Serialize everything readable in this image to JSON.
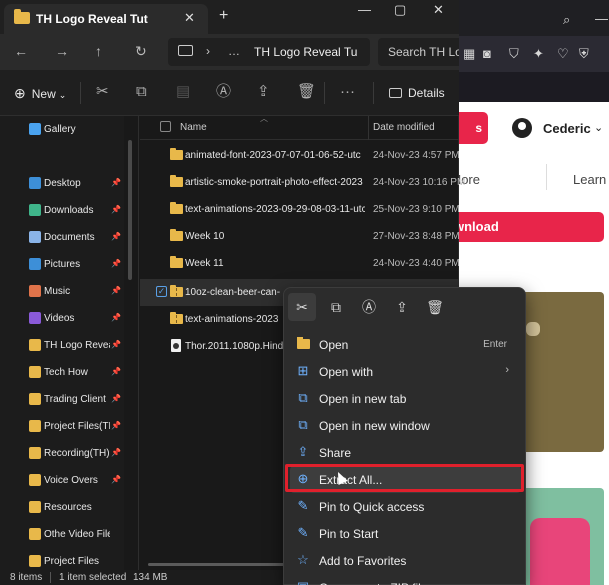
{
  "browser": {
    "user_name": "Cederic",
    "tab_more": "More",
    "tab_learn": "Learn",
    "download_label": "Download"
  },
  "explorer": {
    "tab_title": "TH Logo Reveal Tut",
    "close_tab": "✕",
    "new_tab": "+",
    "window_minimize": "—",
    "window_maximize": "▢",
    "window_close": "✕",
    "address_crumb": "TH Logo Reveal Tu",
    "search_placeholder": "Search TH Logo",
    "toolbar": {
      "new_label": "New",
      "details_label": "Details"
    },
    "sidebar": [
      {
        "label": "Gallery",
        "icon": "gallery-icon",
        "color": "#4aa3f0",
        "pinned": false
      },
      {
        "label": "Desktop",
        "icon": "desktop-icon",
        "color": "#3d8fd8",
        "pinned": true
      },
      {
        "label": "Downloads",
        "icon": "downloads-icon",
        "color": "#3fb58a",
        "pinned": true
      },
      {
        "label": "Documents",
        "icon": "documents-icon",
        "color": "#8ab4e8",
        "pinned": true
      },
      {
        "label": "Pictures",
        "icon": "pictures-icon",
        "color": "#3d8fd8",
        "pinned": true
      },
      {
        "label": "Music",
        "icon": "music-icon",
        "color": "#e0734a",
        "pinned": true
      },
      {
        "label": "Videos",
        "icon": "videos-icon",
        "color": "#8a5ad8",
        "pinned": true
      },
      {
        "label": "TH Logo Reveal",
        "icon": "folder-icon",
        "color": "#e8b84a",
        "pinned": true
      },
      {
        "label": "Tech How",
        "icon": "folder-icon",
        "color": "#e8b84a",
        "pinned": true
      },
      {
        "label": "Trading Client",
        "icon": "folder-icon",
        "color": "#e8b84a",
        "pinned": true
      },
      {
        "label": "Project Files(TH",
        "icon": "folder-icon",
        "color": "#e8b84a",
        "pinned": true
      },
      {
        "label": "Recording(TH)",
        "icon": "folder-icon",
        "color": "#e8b84a",
        "pinned": true
      },
      {
        "label": "Voice Overs",
        "icon": "folder-icon",
        "color": "#e8b84a",
        "pinned": true
      },
      {
        "label": "Resources",
        "icon": "folder-icon",
        "color": "#e8b84a",
        "pinned": false
      },
      {
        "label": "Othe Video Files",
        "icon": "folder-icon",
        "color": "#e8b84a",
        "pinned": false
      },
      {
        "label": "Project Files",
        "icon": "folder-icon",
        "color": "#e8b84a",
        "pinned": false
      }
    ],
    "columns": {
      "name": "Name",
      "date": "Date modified"
    },
    "files": [
      {
        "name": "animated-font-2023-07-07-01-06-52-utc",
        "date": "24-Nov-23 4:57 PM",
        "type": "folder"
      },
      {
        "name": "artistic-smoke-portrait-photo-effect-2023",
        "date": "24-Nov-23 10:16 PM",
        "type": "folder"
      },
      {
        "name": "text-animations-2023-09-29-08-03-11-utc",
        "date": "25-Nov-23 9:10 PM",
        "type": "folder"
      },
      {
        "name": "Week 10",
        "date": "27-Nov-23 8:48 PM",
        "type": "folder"
      },
      {
        "name": "Week 11",
        "date": "24-Nov-23 4:40 PM",
        "type": "folder"
      },
      {
        "name": "10oz-clean-beer-can-",
        "date": "",
        "type": "zip",
        "selected": true
      },
      {
        "name": "text-animations-2023",
        "date": "",
        "type": "zip"
      },
      {
        "name": "Thor.2011.1080p.Hindi",
        "date": "",
        "type": "video"
      }
    ],
    "status": {
      "items": "8 items",
      "selected": "1 item selected",
      "size": "134 MB"
    }
  },
  "context_menu": {
    "toolbar": [
      "cut-icon",
      "copy-icon",
      "rename-icon",
      "share-icon",
      "delete-icon"
    ],
    "items": [
      {
        "label": "Open",
        "shortcut": "Enter",
        "icon": "folder-open-icon"
      },
      {
        "label": "Open with",
        "submenu": "›",
        "icon": "open-with-icon"
      },
      {
        "label": "Open in new tab",
        "icon": "new-tab-icon"
      },
      {
        "label": "Open in new window",
        "icon": "new-window-icon"
      },
      {
        "label": "Share",
        "icon": "share-icon"
      },
      {
        "label": "Extract All...",
        "icon": "extract-icon",
        "highlighted": true
      },
      {
        "label": "Pin to Quick access",
        "icon": "pin-icon"
      },
      {
        "label": "Pin to Start",
        "icon": "pin-start-icon"
      },
      {
        "label": "Add to Favorites",
        "icon": "star-icon"
      },
      {
        "label": "Compress to ZIP file",
        "icon": "zip-icon"
      }
    ]
  }
}
